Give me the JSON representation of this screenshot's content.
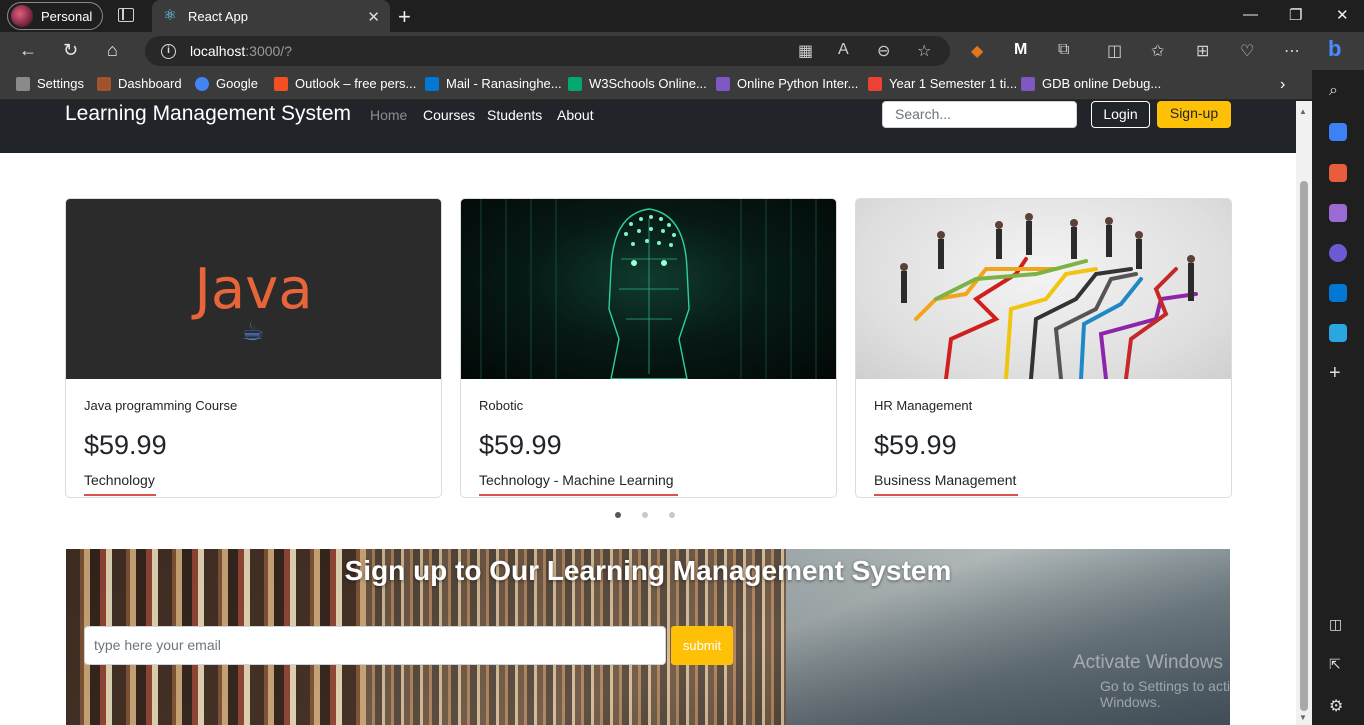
{
  "browser": {
    "profile_label": "Personal",
    "tab_title": "React App",
    "url_host": "localhost",
    "url_rest": ":3000/?",
    "bookmarks": [
      {
        "label": "Settings",
        "color": "#8a8a8a"
      },
      {
        "label": "Dashboard",
        "color": "#a0522d"
      },
      {
        "label": "Google",
        "color": "#4285f4"
      },
      {
        "label": "Outlook – free pers...",
        "color": "#f25022"
      },
      {
        "label": "Mail - Ranasinghe...",
        "color": "#0078d4"
      },
      {
        "label": "W3Schools Online...",
        "color": "#04aa6d"
      },
      {
        "label": "Online Python Inter...",
        "color": "#7e57c2"
      },
      {
        "label": "Year 1 Semester 1 ti...",
        "color": "#ea4335"
      },
      {
        "label": "GDB online Debug...",
        "color": "#7e57c2"
      }
    ]
  },
  "navbar": {
    "brand": "Learning Management System",
    "links": [
      "Home",
      "Courses",
      "Students",
      "About"
    ],
    "search_placeholder": "Search...",
    "login_label": "Login",
    "signup_label": "Sign-up"
  },
  "courses": [
    {
      "title": "Java programming Course",
      "price": "$59.99",
      "category": "Technology",
      "image_text": "Java"
    },
    {
      "title": "Robotic",
      "price": "$59.99",
      "category": "Technology - Machine Learning"
    },
    {
      "title": "HR Management",
      "price": "$59.99",
      "category": "Business Management"
    }
  ],
  "carousel": {
    "total": 3,
    "active": 0
  },
  "signup_banner": {
    "title": "Sign up to Our Learning Management System",
    "email_placeholder": "type here your email",
    "submit_label": "submit"
  },
  "watermark": {
    "line1": "Activate Windows",
    "line2": "Go to Settings to activate Windows."
  },
  "colors": {
    "navbar_bg": "#212529",
    "accent_yellow": "#ffc107",
    "underline_red": "#d9534f"
  }
}
